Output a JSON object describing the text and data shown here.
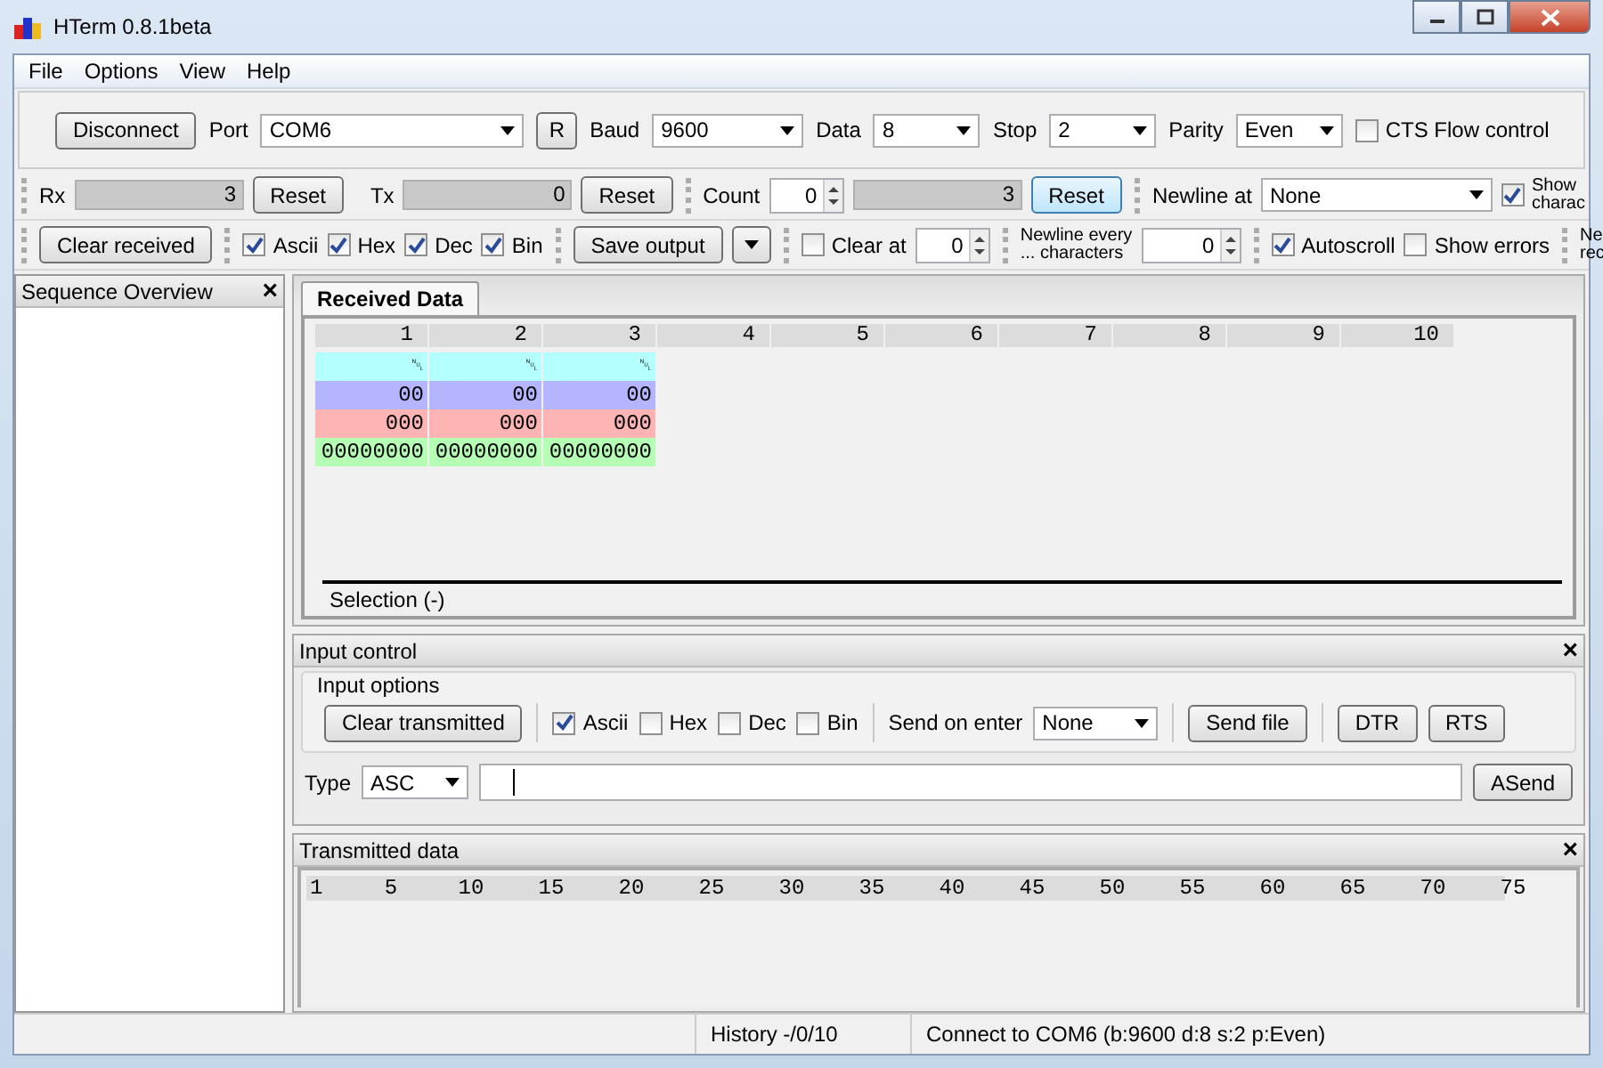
{
  "window": {
    "title": "HTerm 0.8.1beta"
  },
  "menu": [
    "File",
    "Options",
    "View",
    "Help"
  ],
  "connection": {
    "button": "Disconnect",
    "port_label": "Port",
    "port": "COM6",
    "refresh": "R",
    "baud_label": "Baud",
    "baud": "9600",
    "data_label": "Data",
    "data": "8",
    "stop_label": "Stop",
    "stop": "2",
    "parity_label": "Parity",
    "parity": "Even",
    "cts": {
      "label": "CTS Flow control",
      "checked": false
    }
  },
  "counters": {
    "rx_label": "Rx",
    "rx": "3",
    "rx_reset": "Reset",
    "tx_label": "Tx",
    "tx": "0",
    "tx_reset": "Reset",
    "count_label": "Count",
    "count": "0",
    "count_value": "3",
    "count_reset": "Reset",
    "newline_label": "Newline at",
    "newline": "None",
    "show": {
      "label_lines": [
        "Show",
        "charac"
      ],
      "checked": true
    }
  },
  "display": {
    "clear": "Clear received",
    "formats": [
      {
        "label": "Ascii",
        "checked": true
      },
      {
        "label": "Hex",
        "checked": true
      },
      {
        "label": "Dec",
        "checked": true
      },
      {
        "label": "Bin",
        "checked": true
      }
    ],
    "save": "Save output",
    "clear_at": {
      "label": "Clear at",
      "checked": false,
      "value": "0"
    },
    "newline_every": {
      "label_lines": [
        "Newline every",
        "... characters"
      ],
      "value": "0"
    },
    "options": [
      {
        "label": "Autoscroll",
        "checked": true
      },
      {
        "label": "Show errors",
        "checked": false
      }
    ],
    "cut_label_lines": [
      "Ne",
      "rec"
    ]
  },
  "sequence_overview": {
    "title": "Sequence Overview",
    "close": "×"
  },
  "received": {
    "tab": "Received Data",
    "columns": [
      "1",
      "2",
      "3",
      "4",
      "5",
      "6",
      "7",
      "8",
      "9",
      "10"
    ],
    "rows": [
      {
        "kind": "ascii",
        "color": "#b4ffff",
        "cells": [
          "␀",
          "␀",
          "␀"
        ]
      },
      {
        "kind": "hex",
        "color": "#b4b4ff",
        "cells": [
          "00",
          "00",
          "00"
        ]
      },
      {
        "kind": "dec",
        "color": "#ffb4b4",
        "cells": [
          "000",
          "000",
          "000"
        ]
      },
      {
        "kind": "bin",
        "color": "#b4ffb4",
        "cells": [
          "00000000",
          "00000000",
          "00000000"
        ]
      }
    ],
    "selection": "Selection (-)"
  },
  "input_control": {
    "title": "Input control",
    "close": "×",
    "options_title": "Input options",
    "clear": "Clear transmitted",
    "formats": [
      {
        "label": "Ascii",
        "checked": true
      },
      {
        "label": "Hex",
        "checked": false
      },
      {
        "label": "Dec",
        "checked": false
      },
      {
        "label": "Bin",
        "checked": false
      }
    ],
    "send_on_enter_label": "Send on enter",
    "send_on_enter": "None",
    "send_file": "Send file",
    "dtr": "DTR",
    "rts": "RTS",
    "type_label": "Type",
    "type": "ASC",
    "send": "ASend"
  },
  "transmitted": {
    "title": "Transmitted data",
    "close": "×",
    "ruler": [
      "1",
      "5",
      "10",
      "15",
      "20",
      "25",
      "30",
      "35",
      "40",
      "45",
      "50",
      "55",
      "60",
      "65",
      "70",
      "75"
    ]
  },
  "status_bar": [
    "History -/0/10",
    "Connect to COM6 (b:9600 d:8 s:2 p:Even)"
  ]
}
